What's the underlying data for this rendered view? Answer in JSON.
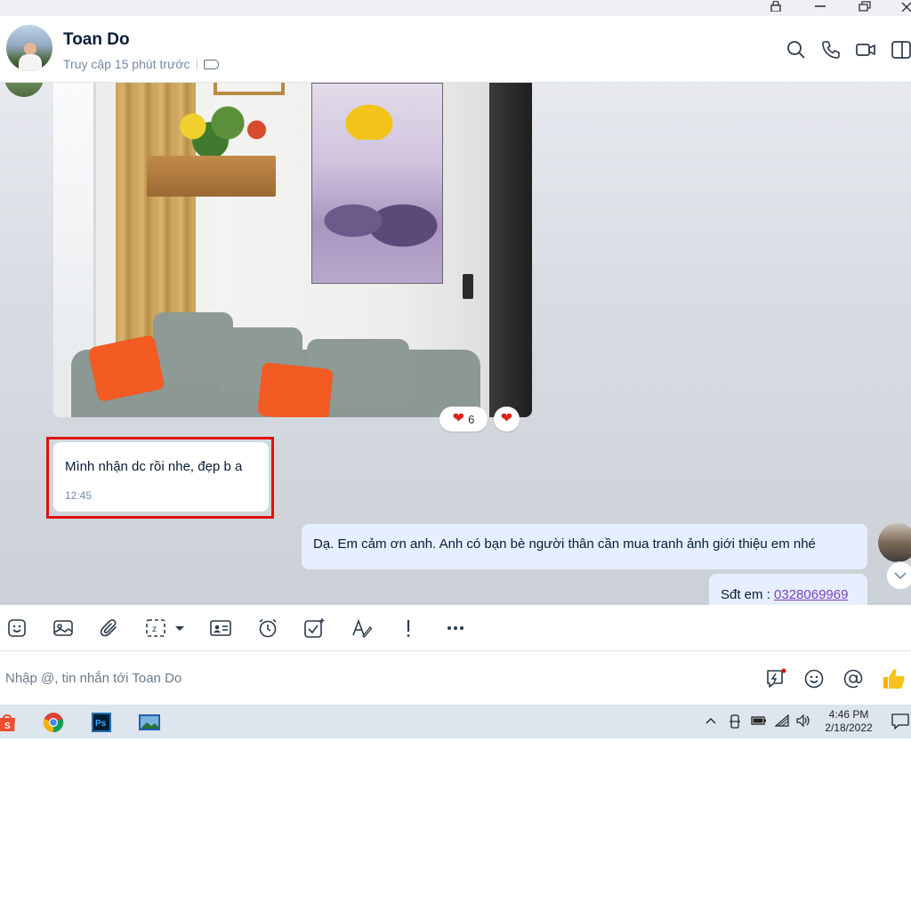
{
  "window": {
    "controls": [
      "lock-icon",
      "minimize-icon",
      "restore-icon",
      "close-icon"
    ]
  },
  "header": {
    "contact_name": "Toan Do",
    "status": "Truy cập 15 phút trước",
    "actions": [
      "search-icon",
      "phone-icon",
      "video-icon",
      "sidebar-toggle-icon"
    ]
  },
  "messages": {
    "image_reactions": {
      "count": "6",
      "emoji": "❤️"
    },
    "incoming": {
      "text": "Mình nhận dc rồi nhe, đẹp b a",
      "time": "12:45"
    },
    "outgoing": [
      {
        "text": "Dạ. Em cảm ơn anh. Anh có bạn bè người thân cần mua tranh ảnh giới thiệu em nhé"
      },
      {
        "prefix": "Sđt em : ",
        "phone": "0328069969"
      }
    ]
  },
  "toolbar": {
    "tools": [
      "sticker-icon",
      "image-icon",
      "attachment-icon",
      "screenshot-icon",
      "business-card-icon",
      "reminder-icon",
      "task-icon",
      "text-format-icon",
      "important-icon",
      "more-icon"
    ]
  },
  "composer": {
    "placeholder": "Nhập @, tin nhắn tới Toan Do",
    "actions": [
      "quick-message-icon",
      "emoji-icon",
      "mention-icon",
      "like-icon"
    ]
  },
  "taskbar": {
    "apps": [
      "shopee-icon",
      "chrome-icon",
      "photoshop-icon",
      "photos-icon"
    ],
    "time": "4:46 PM",
    "date": "2/18/2022"
  },
  "colors": {
    "accent": "#0068ff",
    "highlight": "#e10f0f",
    "outgoing_bubble": "#e5efff",
    "link": "#7f3fbf"
  }
}
